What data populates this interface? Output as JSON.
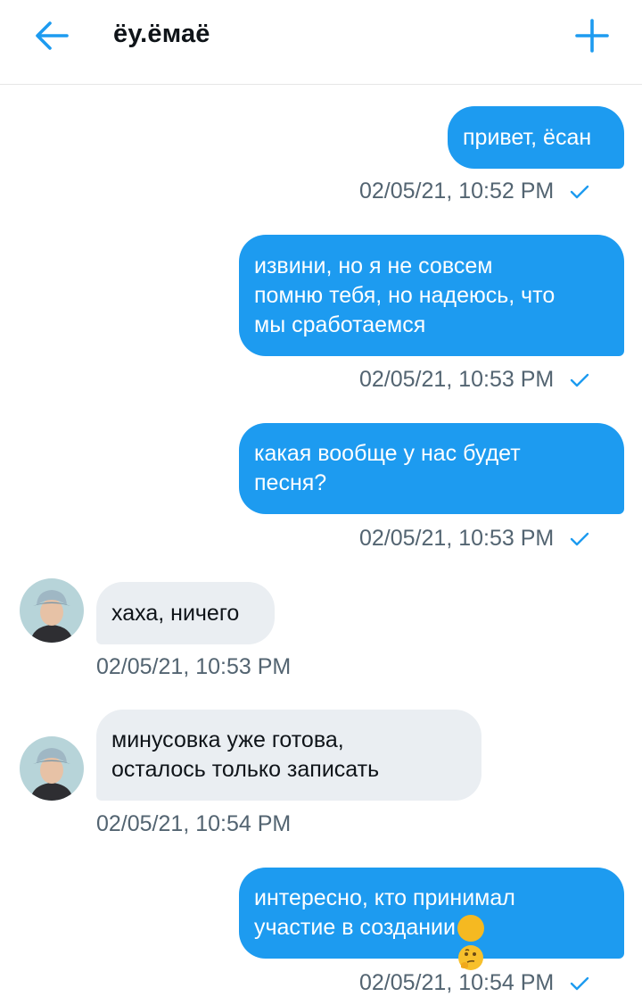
{
  "header": {
    "title": "ёу.ёмаё",
    "back_icon": "arrow-left-icon",
    "add_icon": "plus-icon",
    "accent": "#1d9bf0"
  },
  "messages": [
    {
      "direction": "outgoing",
      "text": "привет, ёсан",
      "timestamp": "02/05/21, 10:52 PM",
      "status_icon": "check-icon"
    },
    {
      "direction": "outgoing",
      "text": "извини, но я не совсем\nпомню тебя, но надеюсь, что\nмы сработаемся",
      "timestamp": "02/05/21, 10:53 PM",
      "status_icon": "check-icon"
    },
    {
      "direction": "outgoing",
      "text": "какая вообще у нас будет\nпесня?",
      "timestamp": "02/05/21, 10:53 PM",
      "status_icon": "check-icon"
    },
    {
      "direction": "incoming",
      "text": "хаха, ничего",
      "timestamp": "02/05/21, 10:53 PM"
    },
    {
      "direction": "incoming",
      "text": "минусовка уже готова,\nосталось только записать",
      "timestamp": "02/05/21, 10:54 PM"
    },
    {
      "direction": "outgoing",
      "text": "интересно, кто принимал\nучастие в создании",
      "emoji": "thinking-face-icon",
      "timestamp": "02/05/21, 10:54 PM",
      "status_icon": "check-icon"
    }
  ]
}
